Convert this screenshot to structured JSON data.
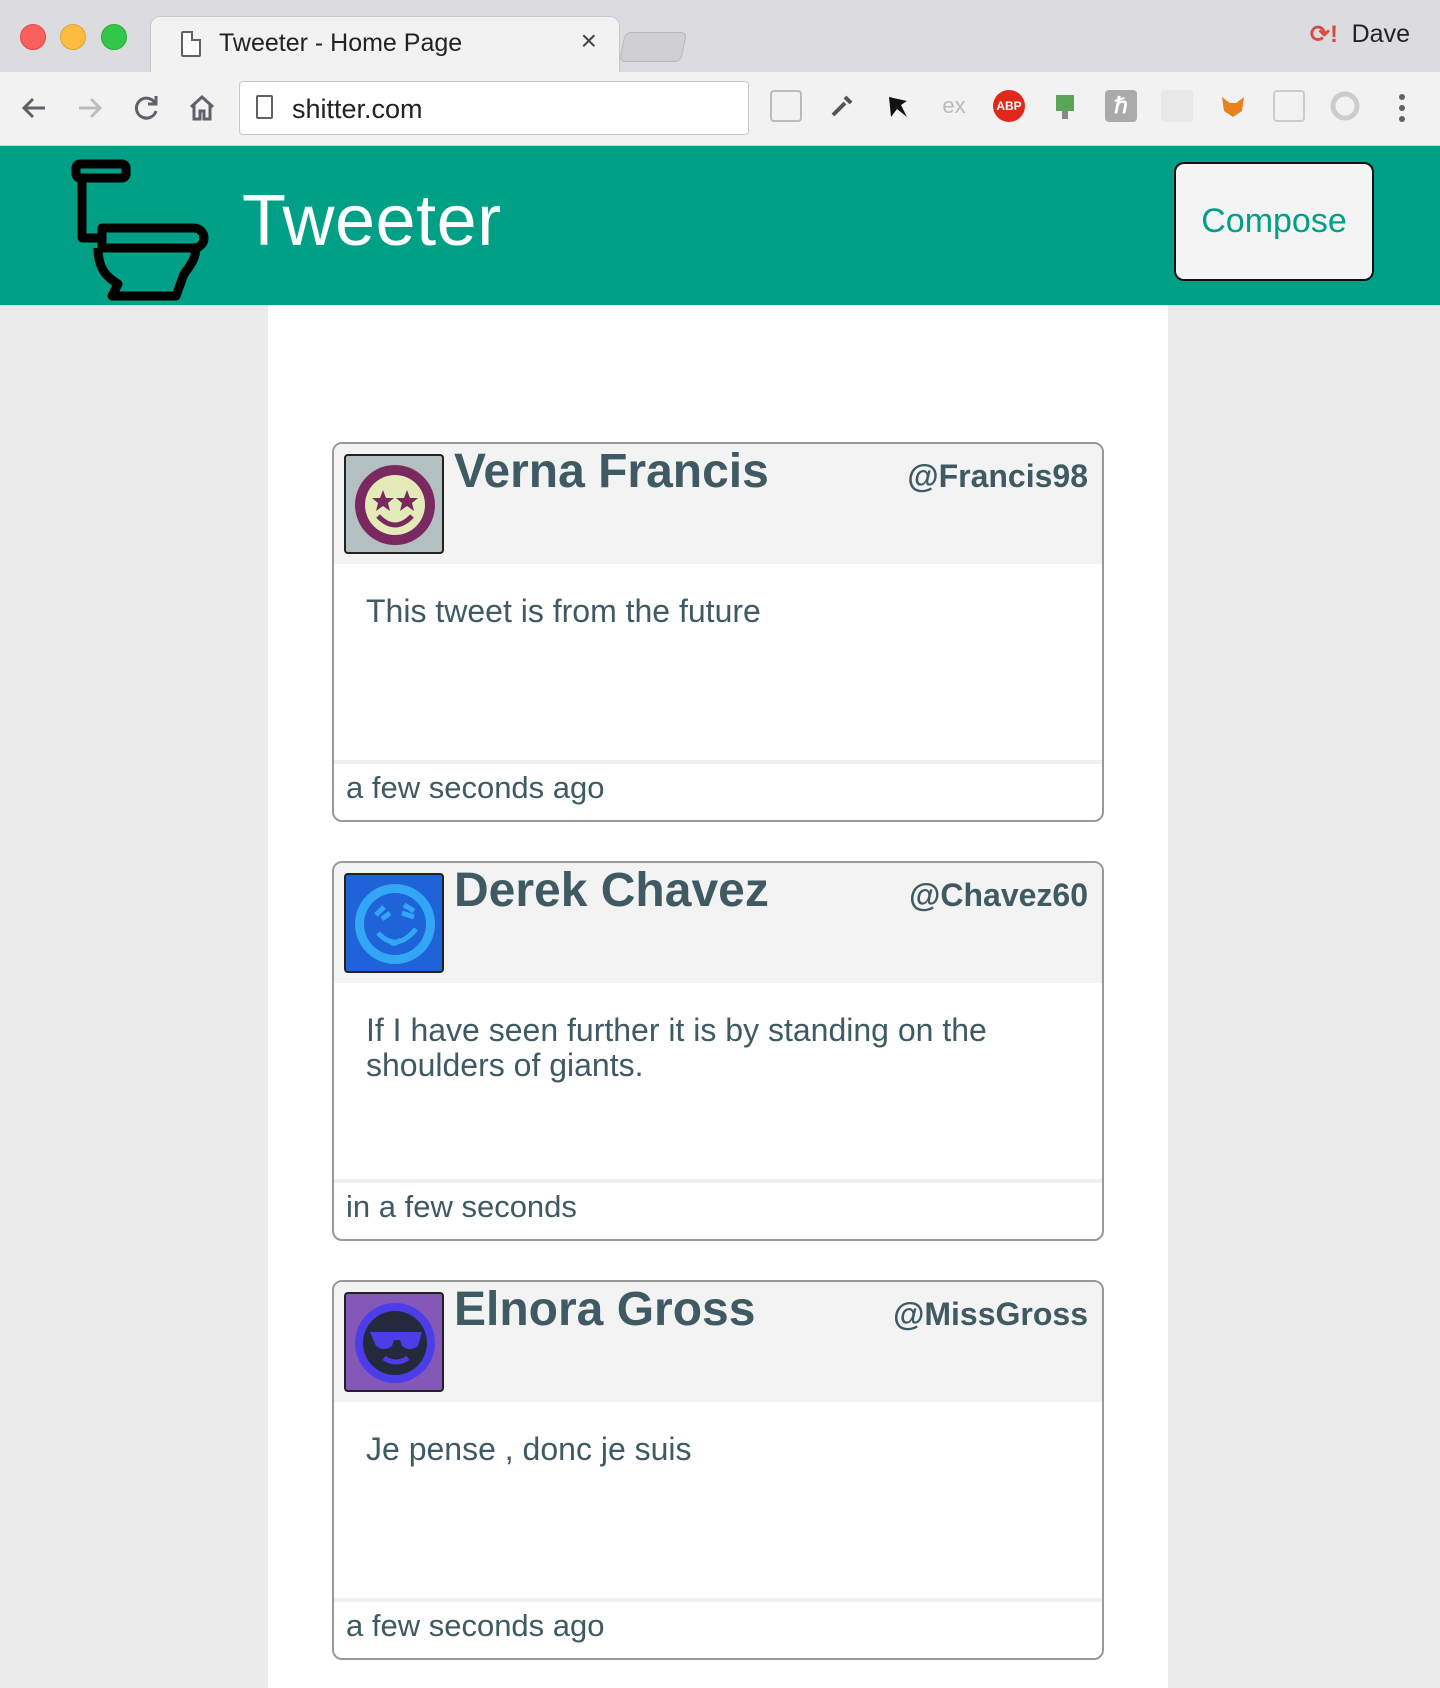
{
  "browser": {
    "tab_title": "Tweeter - Home Page",
    "tab_close": "×",
    "profile_name": "Dave",
    "url": "shitter.com",
    "extensions": [
      "reader-icon",
      "eyedropper-icon",
      "ninja-icon",
      "ex-icon",
      "adblock-icon",
      "plugin-icon",
      "h-icon",
      "note-icon",
      "fox-icon",
      "window-icon",
      "circle-icon"
    ],
    "adblock_label": "ABP",
    "ex_label": "ex",
    "h_label": "ℏ"
  },
  "app": {
    "title": "Tweeter",
    "compose_label": "Compose",
    "accent_color": "#00a087"
  },
  "tweets": [
    {
      "name": "Verna Francis",
      "handle": "@Francis98",
      "content": "This tweet is from the future",
      "time": "a few seconds ago",
      "avatar": "star-eyes-smiley-icon"
    },
    {
      "name": "Derek Chavez",
      "handle": "@Chavez60",
      "content": "If I have seen further it is by standing on the shoulders of giants.",
      "time": "in a few seconds",
      "avatar": "crazy-face-icon"
    },
    {
      "name": "Elnora Gross",
      "handle": "@MissGross",
      "content": "Je pense , donc je suis",
      "time": "a few seconds ago",
      "avatar": "sunglasses-face-icon"
    }
  ]
}
